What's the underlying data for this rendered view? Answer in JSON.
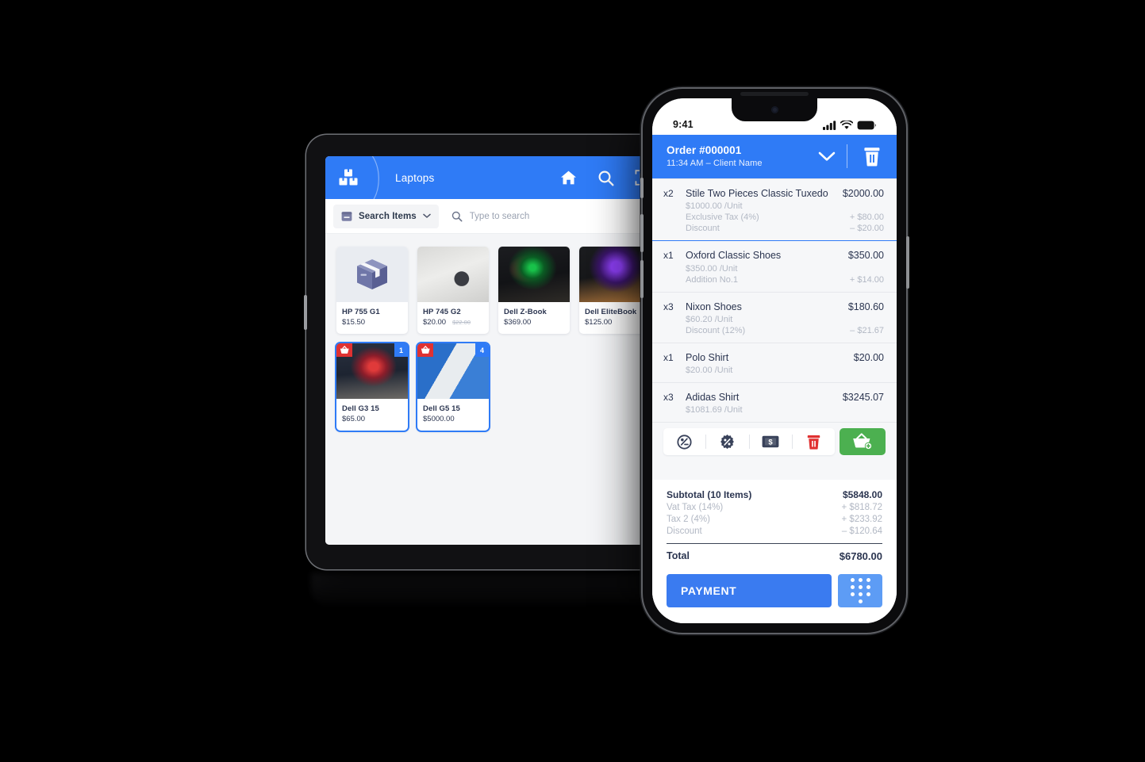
{
  "background_color": "#000000",
  "accent_blue": "#2f7bf6",
  "accent_green": "#4cb050",
  "accent_red": "#e03131",
  "tablet": {
    "header": {
      "logo_icon": "boxes-stack-icon",
      "category_label": "Laptops",
      "actions": [
        {
          "icon": "home-icon",
          "name": "home-button"
        },
        {
          "icon": "search-icon",
          "name": "search-button"
        },
        {
          "icon": "barcode-scan-icon",
          "name": "barcode-scan-button"
        }
      ]
    },
    "search": {
      "select_icon": "archive-box-icon",
      "select_label": "Search Items",
      "chevron_icon": "chevron-down-icon",
      "search_icon": "search-icon",
      "placeholder": "Type to search",
      "value": ""
    },
    "products": [
      {
        "name": "HP 755 G1",
        "price": "$15.50",
        "old_price": "",
        "art": "art-box",
        "qty_badge": "",
        "cart_badge": false,
        "selected": false
      },
      {
        "name": "HP 745 G2",
        "price": "$20.00",
        "old_price": "$22.00",
        "art": "art-hp745",
        "qty_badge": "",
        "cart_badge": false,
        "selected": false
      },
      {
        "name": "Dell Z-Book",
        "price": "$369.00",
        "old_price": "",
        "art": "art-zbook",
        "qty_badge": "",
        "cart_badge": false,
        "selected": false
      },
      {
        "name": "Dell EliteBook",
        "price": "$125.00",
        "old_price": "",
        "art": "art-elite",
        "qty_badge": "",
        "cart_badge": false,
        "selected": false
      },
      {
        "name": "Dell G3 15",
        "price": "$65.00",
        "old_price": "",
        "art": "art-g3",
        "qty_badge": "1",
        "cart_badge": true,
        "selected": true
      },
      {
        "name": "Dell G5 15",
        "price": "$5000.00",
        "old_price": "",
        "art": "art-g5",
        "qty_badge": "4",
        "cart_badge": true,
        "selected": true
      }
    ]
  },
  "phone": {
    "statusbar": {
      "time": "9:41",
      "icons": [
        "cellular-signal-icon",
        "wifi-icon",
        "battery-icon"
      ]
    },
    "order_header": {
      "title": "Order #000001",
      "subtitle": "11:34 AM – Client Name",
      "chevron_icon": "chevron-down-icon",
      "trash_icon": "trash-icon"
    },
    "items": [
      {
        "qty": "x2",
        "name": "Stile Two Pieces Classic Tuxedo",
        "amount": "$2000.00",
        "active": true,
        "lines": [
          {
            "label": "$1000.00 /Unit",
            "value": ""
          },
          {
            "label": "Exclusive Tax (4%)",
            "value": "+  $80.00"
          },
          {
            "label": "Discount",
            "value": "–  $20.00"
          }
        ]
      },
      {
        "qty": "x1",
        "name": "Oxford Classic Shoes",
        "amount": "$350.00",
        "active": false,
        "lines": [
          {
            "label": "$350.00 /Unit",
            "value": ""
          },
          {
            "label": "Addition No.1",
            "value": "+  $14.00"
          }
        ]
      },
      {
        "qty": "x3",
        "name": "Nixon Shoes",
        "amount": "$180.60",
        "active": false,
        "lines": [
          {
            "label": "$60.20 /Unit",
            "value": ""
          },
          {
            "label": "Discount (12%)",
            "value": "–  $21.67"
          }
        ]
      },
      {
        "qty": "x1",
        "name": "Polo Shirt",
        "amount": "$20.00",
        "active": false,
        "lines": [
          {
            "label": "$20.00 /Unit",
            "value": ""
          }
        ]
      },
      {
        "qty": "x3",
        "name": "Adidas Shirt",
        "amount": "$3245.07",
        "active": false,
        "lines": [
          {
            "label": "$1081.69 /Unit",
            "value": ""
          }
        ]
      }
    ],
    "item_actions": [
      {
        "icon": "percent-off-circle-icon",
        "name": "modify-price-button"
      },
      {
        "icon": "discount-badge-icon",
        "name": "discount-button"
      },
      {
        "icon": "cash-note-icon",
        "name": "price-button"
      },
      {
        "icon": "trash-icon",
        "name": "delete-item-button"
      }
    ],
    "add_to_cart": {
      "icon": "basket-plus-icon",
      "name": "add-to-basket-button"
    },
    "totals": [
      {
        "label": "Subtotal (10 Items)",
        "value": "$5848.00",
        "emphasis": true
      },
      {
        "label": "Vat Tax (14%)",
        "value": "+  $818.72",
        "emphasis": false
      },
      {
        "label": "Tax 2 (4%)",
        "value": "+  $233.92",
        "emphasis": false
      },
      {
        "label": "Discount",
        "value": "–  $120.64",
        "emphasis": false
      }
    ],
    "grand_total": {
      "label": "Total",
      "value": "$6780.00"
    },
    "payment_button": {
      "label": "PAYMENT",
      "name": "payment-button"
    },
    "keypad_button": {
      "icon": "numeric-keypad-icon",
      "name": "keypad-button"
    }
  }
}
